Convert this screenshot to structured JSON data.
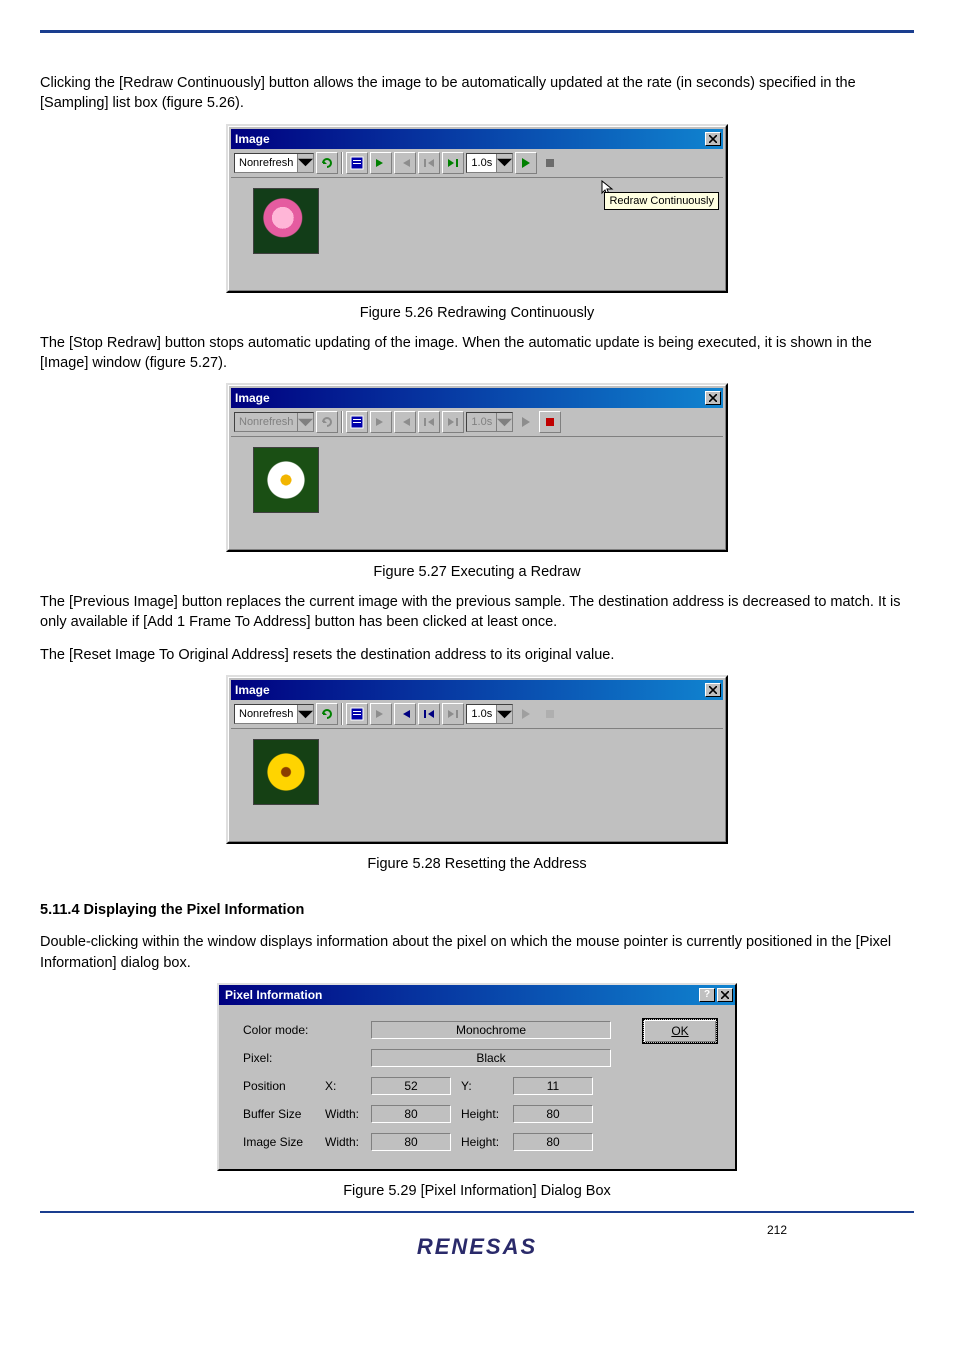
{
  "page_number": "212",
  "footer_brand": "RENESAS",
  "text": {
    "p1": "Clicking the [Redraw Continuously] button allows the image to be automatically updated at the rate (in seconds) specified in the [Sampling] list box (figure 5.26).",
    "cap26": "Figure 5.26   Redrawing Continuously",
    "p2": "The [Stop Redraw] button stops automatic updating of the image. When the automatic update is being executed, it is shown in the [Image] window (figure 5.27).",
    "cap27": "Figure 5.27   Executing a Redraw",
    "p3": "The [Previous Image] button replaces the current image with the previous sample. The destination address is decreased to match. It is only available if [Add 1 Frame To Address] button has been clicked at least once.",
    "p4": "The [Reset Image To Original Address] resets the destination address to its original value.",
    "cap28": "Figure 5.28   Resetting the Address",
    "sec_title": "5.11.4   Displaying the Pixel Information",
    "sec_body": "Double-clicking within the window displays information about the pixel on which the mouse pointer is currently positioned in the [Pixel Information] dialog box.",
    "cap29": "Figure 5.29   [Pixel Information] Dialog Box"
  },
  "image_window": {
    "title": "Image",
    "refresh_options": [
      "Nonrefresh"
    ],
    "selected_refresh": "Nonrefresh",
    "sampling_value": "1.0s",
    "tooltip": "Redraw Continuously",
    "icons": {
      "refresh": "refresh-icon",
      "properties": "properties-icon",
      "next_frame": "next-frame-icon",
      "prev_frame": "prev-frame-icon",
      "reset_frame": "reset-frame-icon",
      "add_frame": "add-frame-icon",
      "play": "play-icon",
      "stop": "stop-icon"
    }
  },
  "pixel_dialog": {
    "title": "Pixel Information",
    "ok": "OK",
    "labels": {
      "color_mode": "Color mode:",
      "pixel": "Pixel:",
      "position": "Position",
      "x": "X:",
      "y": "Y:",
      "buffer": "Buffer Size",
      "image": "Image Size",
      "width": "Width:",
      "height": "Height:"
    },
    "values": {
      "color_mode": "Monochrome",
      "pixel": "Black",
      "x": "52",
      "y": "11",
      "buf_w": "80",
      "buf_h": "80",
      "img_w": "80",
      "img_h": "80"
    }
  }
}
